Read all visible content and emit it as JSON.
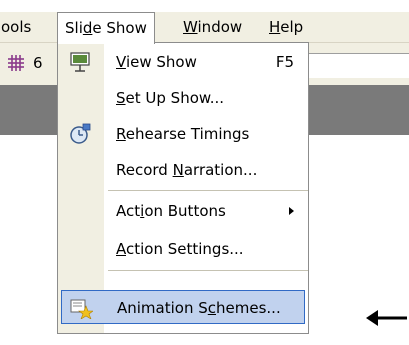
{
  "menubar": {
    "items": [
      {
        "pre": "",
        "u": "",
        "post": "ools"
      },
      {
        "pre": "Sli",
        "u": "d",
        "post": "e Show"
      },
      {
        "pre": "",
        "u": "W",
        "post": "indow"
      },
      {
        "pre": "",
        "u": "H",
        "post": "elp"
      }
    ]
  },
  "toolbar": {
    "value": "6"
  },
  "menu": {
    "items": [
      {
        "pre": "",
        "u": "V",
        "post": "iew Show",
        "shortcut": "F5",
        "icon": "slide-show-projector-icon"
      },
      {
        "pre": "",
        "u": "S",
        "post": "et Up Show..."
      },
      {
        "pre": "",
        "u": "R",
        "post": "ehearse Timings",
        "icon": "stopwatch-icon"
      },
      {
        "pre": "Record ",
        "u": "N",
        "post": "arration..."
      },
      {
        "pre": "Act",
        "u": "i",
        "post": "on Buttons",
        "submenu": true
      },
      {
        "pre": "",
        "u": "A",
        "post": "ction Settings..."
      },
      {
        "pre": "Animation S",
        "u": "c",
        "post": "hemes...",
        "icon": "animation-schemes-icon",
        "highlighted": true
      }
    ]
  },
  "pointer_icon": "left-arrow-icon",
  "colors": {
    "highlight_bg": "#c1d2ee",
    "highlight_border": "#316ac5",
    "menu_gutter": "#f1efe2",
    "workspace": "#7a7a7a"
  }
}
